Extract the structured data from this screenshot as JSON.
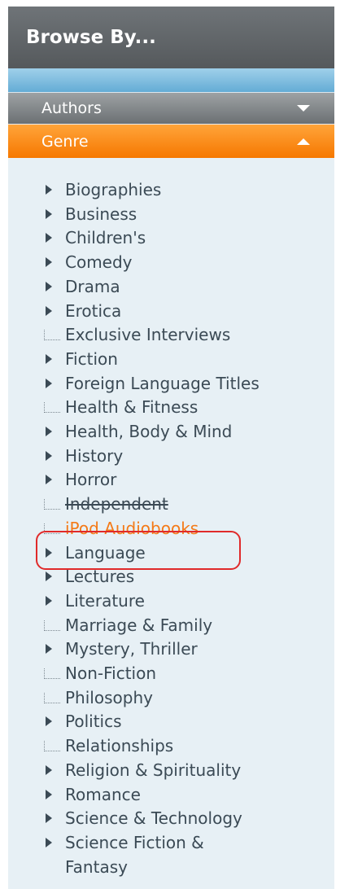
{
  "header": {
    "title": "Browse By..."
  },
  "sections": {
    "authors": {
      "label": "Authors"
    },
    "genre": {
      "label": "Genre"
    }
  },
  "genres": [
    {
      "label": "Biographies",
      "expandable": true
    },
    {
      "label": "Business",
      "expandable": true
    },
    {
      "label": "Children's",
      "expandable": true
    },
    {
      "label": "Comedy",
      "expandable": true
    },
    {
      "label": "Drama",
      "expandable": true
    },
    {
      "label": "Erotica",
      "expandable": true
    },
    {
      "label": "Exclusive Interviews",
      "expandable": false
    },
    {
      "label": "Fiction",
      "expandable": true
    },
    {
      "label": "Foreign Language Titles",
      "expandable": true
    },
    {
      "label": "Health & Fitness",
      "expandable": false
    },
    {
      "label": "Health, Body & Mind",
      "expandable": true
    },
    {
      "label": "History",
      "expandable": true
    },
    {
      "label": "Horror",
      "expandable": true
    },
    {
      "label": "Independent",
      "expandable": false
    },
    {
      "label": "iPod Audiobooks",
      "expandable": false,
      "highlighted": true
    },
    {
      "label": "Language",
      "expandable": true
    },
    {
      "label": "Lectures",
      "expandable": true
    },
    {
      "label": "Literature",
      "expandable": true
    },
    {
      "label": "Marriage & Family",
      "expandable": false
    },
    {
      "label": "Mystery, Thriller",
      "expandable": true
    },
    {
      "label": "Non-Fiction",
      "expandable": false
    },
    {
      "label": "Philosophy",
      "expandable": false
    },
    {
      "label": "Politics",
      "expandable": true
    },
    {
      "label": "Relationships",
      "expandable": false
    },
    {
      "label": "Religion & Spirituality",
      "expandable": true
    },
    {
      "label": "Romance",
      "expandable": true
    },
    {
      "label": "Science & Technology",
      "expandable": true
    },
    {
      "label": "Science Fiction & Fantasy",
      "expandable": true
    }
  ],
  "colors": {
    "highlight": "#f47a17",
    "annotation": "#e02a2a"
  }
}
